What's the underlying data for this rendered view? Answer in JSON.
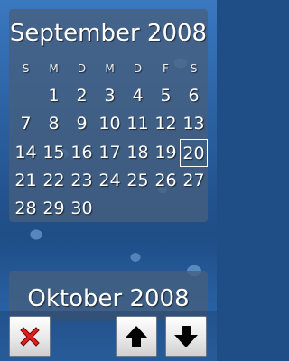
{
  "current_month": {
    "title": "September 2008",
    "weekdays": [
      "S",
      "M",
      "D",
      "M",
      "D",
      "F",
      "S"
    ],
    "weeks": [
      [
        "",
        "1",
        "2",
        "3",
        "4",
        "5",
        "6"
      ],
      [
        "7",
        "8",
        "9",
        "10",
        "11",
        "12",
        "13"
      ],
      [
        "14",
        "15",
        "16",
        "17",
        "18",
        "19",
        "20"
      ],
      [
        "21",
        "22",
        "23",
        "24",
        "25",
        "26",
        "27"
      ],
      [
        "28",
        "29",
        "30",
        "",
        "",
        "",
        ""
      ]
    ],
    "selected_day": "20"
  },
  "next_month": {
    "title": "Oktober 2008"
  },
  "toolbar": {
    "close_icon": "red-x-icon",
    "up_icon": "arrow-up-icon",
    "down_icon": "arrow-down-icon"
  },
  "colors": {
    "close_red": "#e02020",
    "arrow_black": "#000000"
  }
}
